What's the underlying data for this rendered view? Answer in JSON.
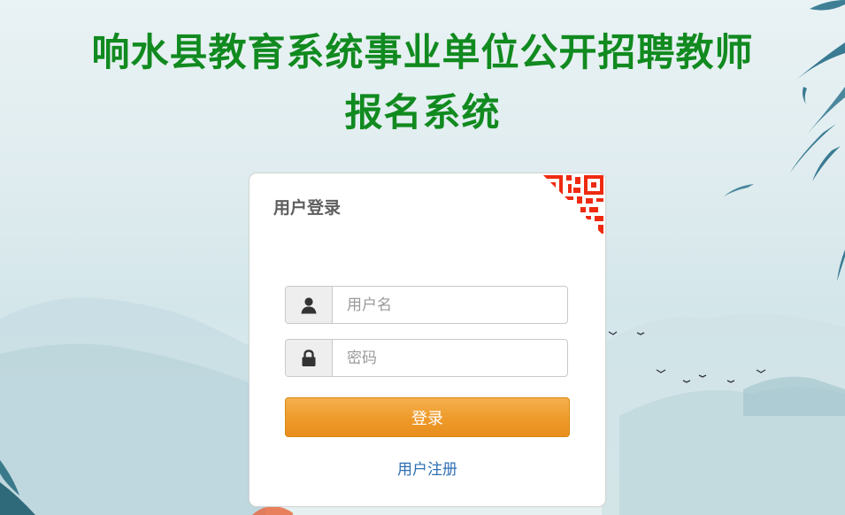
{
  "header": {
    "title_line1": "响水县教育系统事业单位公开招聘教师",
    "title_line2": "报名系统",
    "title_color": "#118a1f"
  },
  "login": {
    "panel_title": "用户登录",
    "username_placeholder": "用户名",
    "password_placeholder": "密码",
    "username_value": "",
    "password_value": "",
    "login_button": "登录",
    "register_link": "用户注册",
    "button_color": "#ee9a2a",
    "link_color": "#2f6fb3"
  },
  "icons": {
    "user": "user-icon",
    "lock": "lock-icon",
    "qr": "qr-code-icon"
  }
}
